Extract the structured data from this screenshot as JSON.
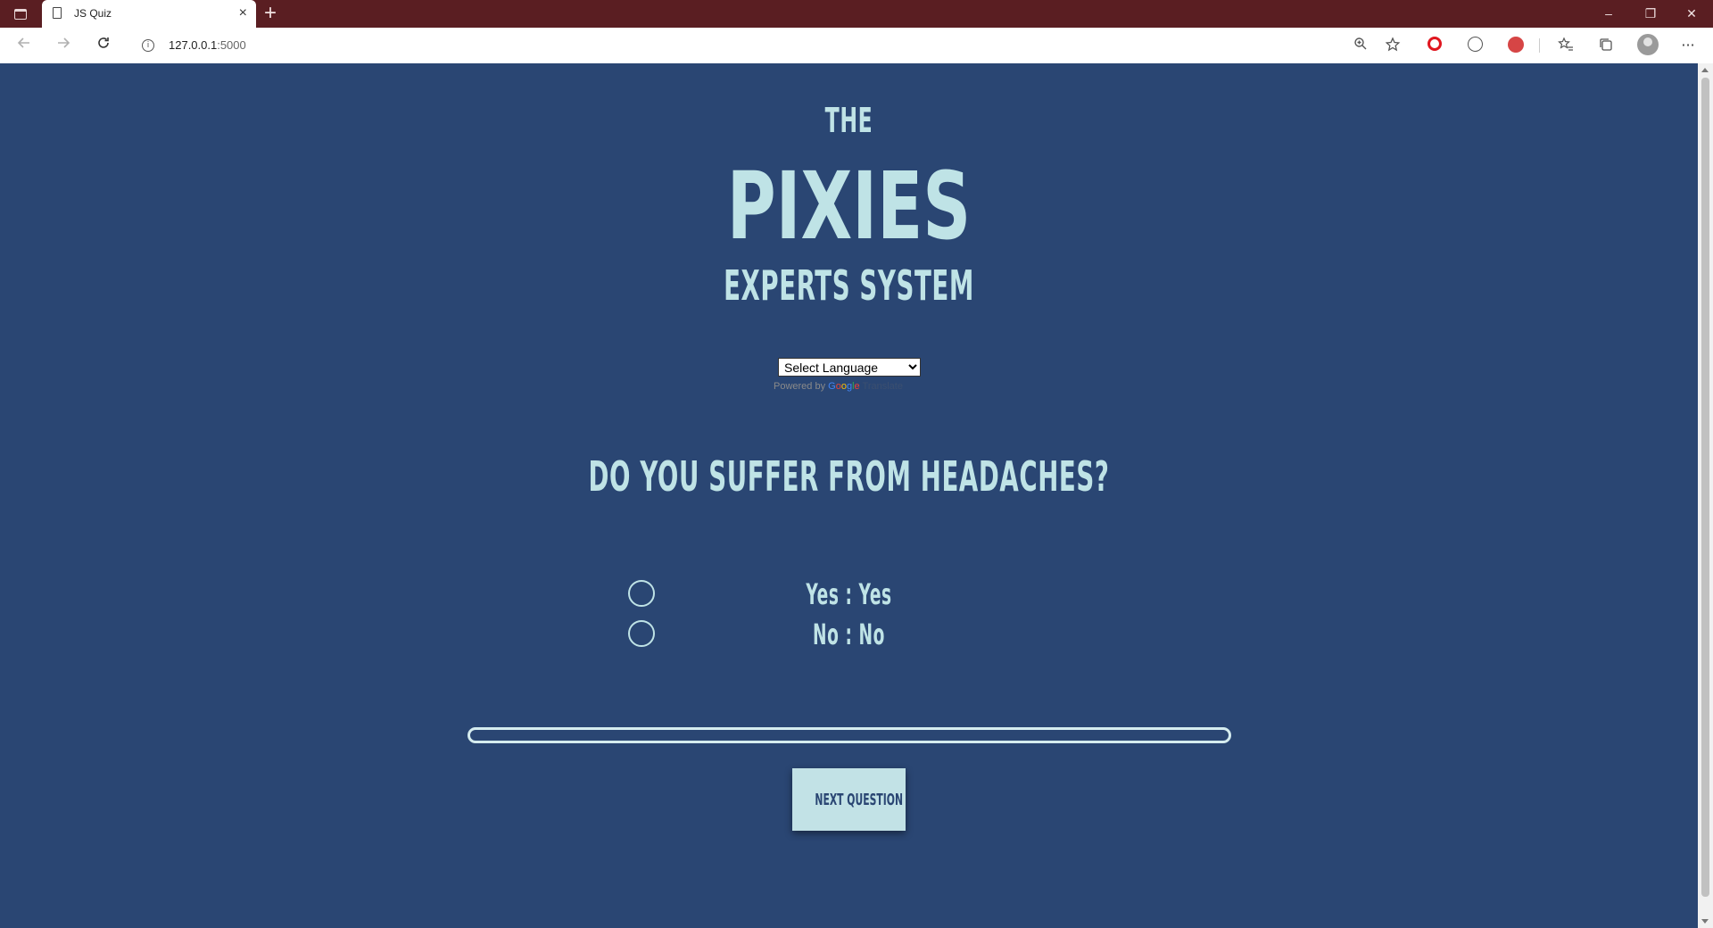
{
  "browser": {
    "tab_title": "JS Quiz",
    "url_host": "127.0.0.1",
    "url_port": ":5000",
    "new_tab": "+",
    "tab_close": "×",
    "window_controls": [
      "–",
      "❐",
      "✕"
    ]
  },
  "header": {
    "the": "The",
    "name": "Pixies",
    "subtitle": "Experts System"
  },
  "translate": {
    "selected": "Select Language",
    "options": [
      "Select Language"
    ],
    "powered_by": "Powered by ",
    "google": [
      "G",
      "o",
      "o",
      "g",
      "l",
      "e"
    ],
    "translate": "Translate"
  },
  "quiz": {
    "question": "Do you suffer from headaches?",
    "options": [
      {
        "label": "Yes : Yes",
        "selected": false
      },
      {
        "label": "No : No",
        "selected": false
      }
    ],
    "progress": 0,
    "next_label": "Next Question"
  },
  "colors": {
    "page_bg": "#2a4673",
    "accent": "#bfe3e6",
    "tab_strip": "#5a1e22"
  }
}
